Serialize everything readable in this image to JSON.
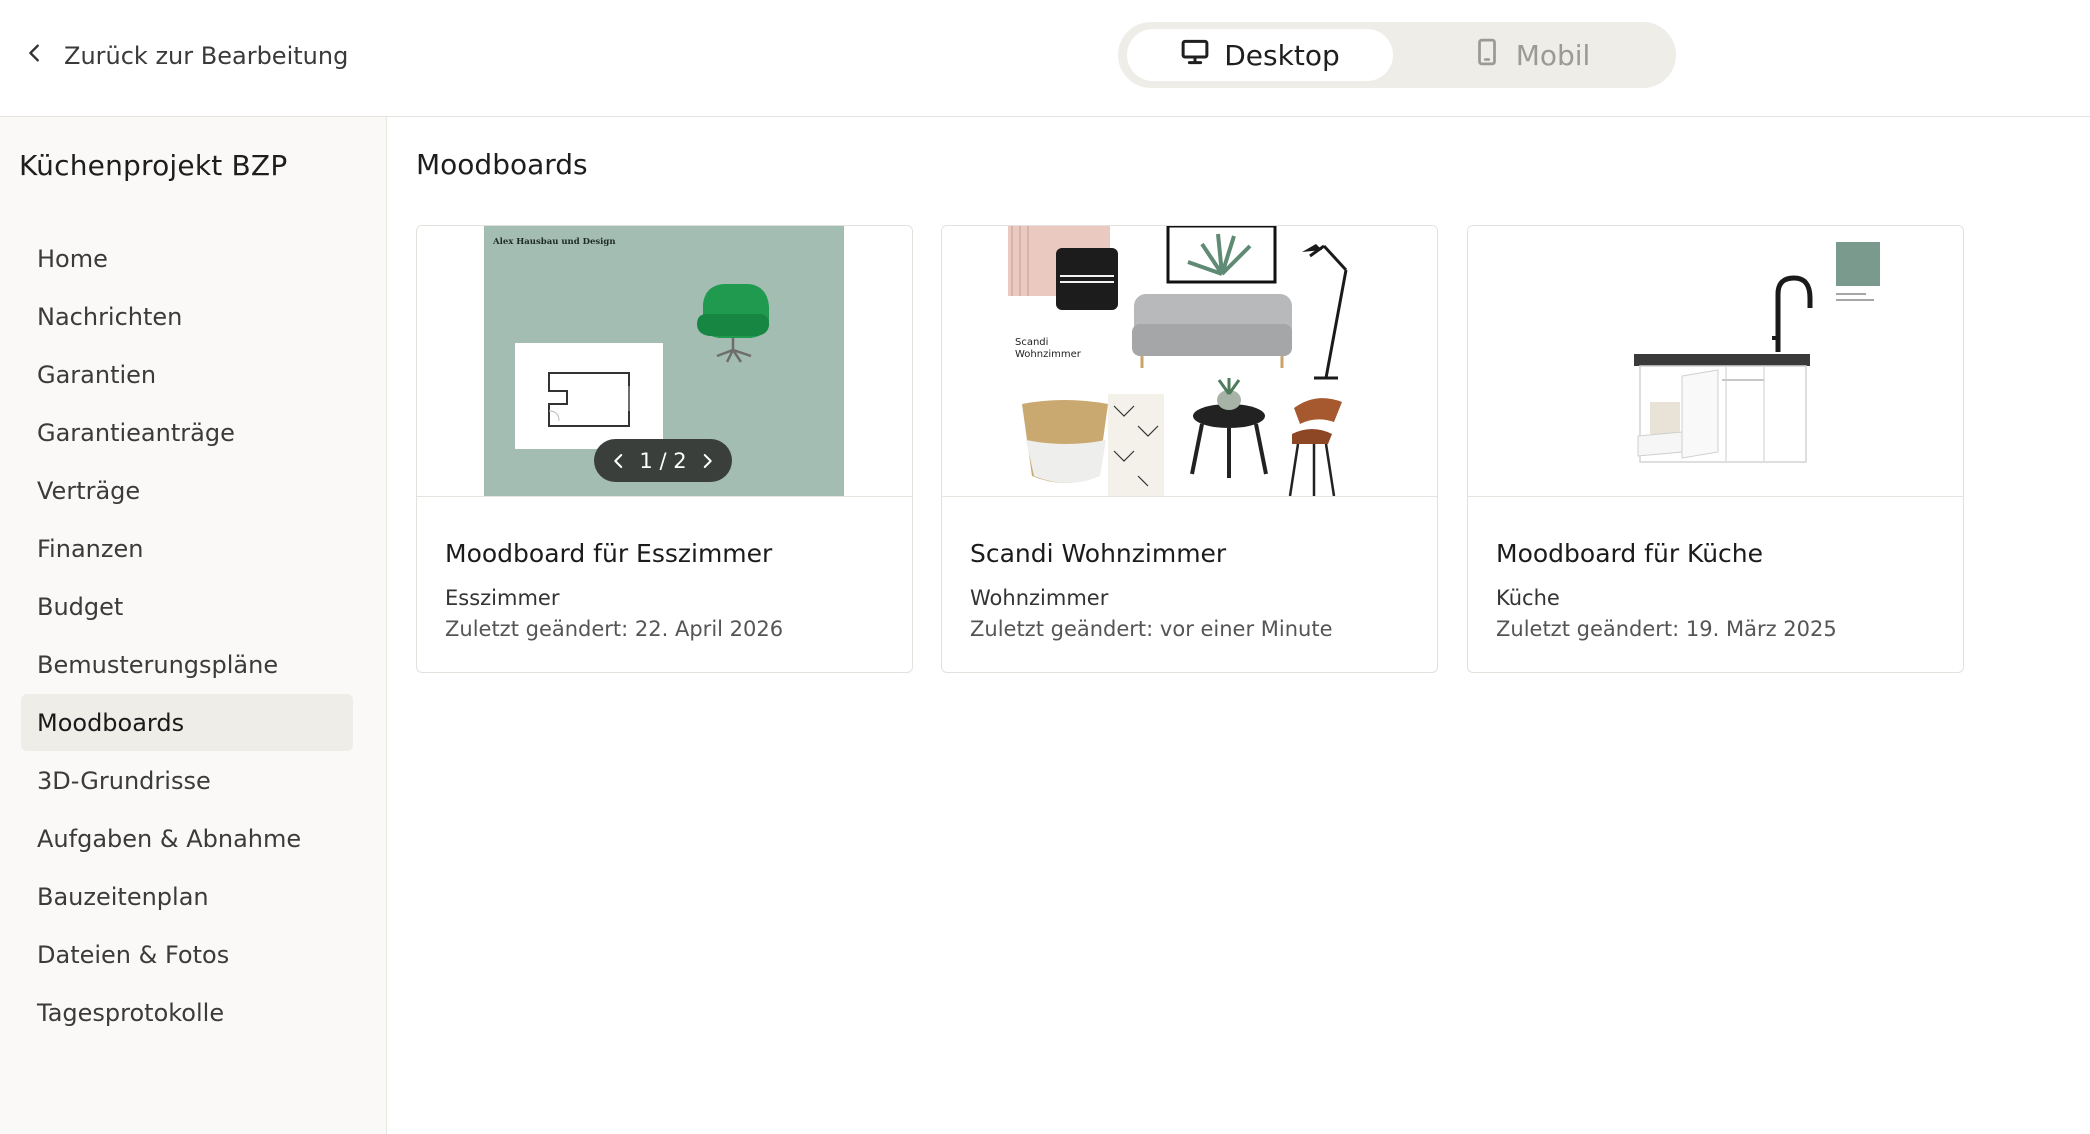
{
  "topbar": {
    "back_label": "Zurück zur Bearbeitung",
    "view_switch": {
      "desktop_label": "Desktop",
      "mobile_label": "Mobil",
      "selected": "Desktop"
    }
  },
  "sidebar": {
    "project_name": "Küchenprojekt BZP",
    "items": [
      {
        "label": "Home"
      },
      {
        "label": "Nachrichten"
      },
      {
        "label": "Garantien"
      },
      {
        "label": "Garantieanträge"
      },
      {
        "label": "Verträge"
      },
      {
        "label": "Finanzen"
      },
      {
        "label": "Budget"
      },
      {
        "label": "Bemusterungspläne"
      },
      {
        "label": "Moodboards",
        "active": true
      },
      {
        "label": "3D-Grundrisse"
      },
      {
        "label": "Aufgaben & Abnahme"
      },
      {
        "label": "Bauzeitenplan"
      },
      {
        "label": "Dateien & Fotos"
      },
      {
        "label": "Tagesprotokolle"
      }
    ]
  },
  "main": {
    "title": "Moodboards",
    "cards": [
      {
        "title": "Moodboard für Esszimmer",
        "room": "Esszimmer",
        "modified": "Zuletzt geändert: 22. April 2026",
        "board_caption": "Alex Hausbau und Design",
        "pager": "1 / 2"
      },
      {
        "title": "Scandi Wohnzimmer",
        "room": "Wohnzimmer",
        "modified": "Zuletzt geändert: vor einer Minute",
        "board_caption_line1": "Scandi",
        "board_caption_line2": "Wohnzimmer"
      },
      {
        "title": "Moodboard für Küche",
        "room": "Küche",
        "modified": "Zuletzt geändert: 19. März 2025"
      }
    ]
  },
  "colors": {
    "sage": "#a3bdb3",
    "chair_green": "#1f9a4e",
    "swatch": "#7a9a8e",
    "pager_bg": "#3b3f3c",
    "active_bg": "#efede8"
  }
}
